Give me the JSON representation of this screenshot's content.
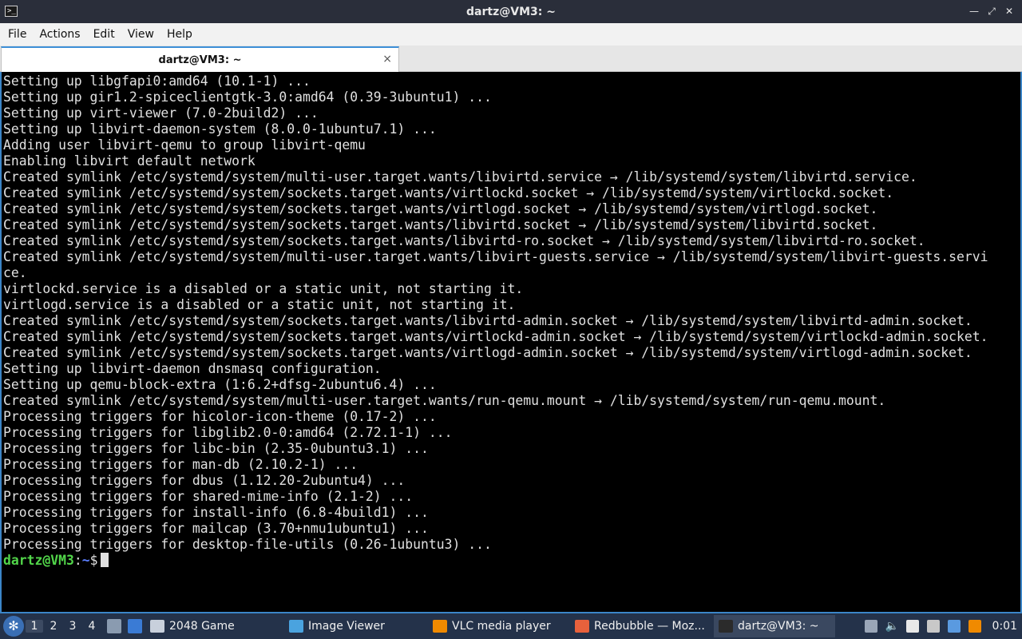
{
  "window": {
    "title": "dartz@VM3: ~"
  },
  "menu": [
    "File",
    "Actions",
    "Edit",
    "View",
    "Help"
  ],
  "tab": {
    "label": "dartz@VM3: ~",
    "close": "×"
  },
  "terminal": {
    "lines": [
      "Setting up libgfapi0:amd64 (10.1-1) ...",
      "Setting up gir1.2-spiceclientgtk-3.0:amd64 (0.39-3ubuntu1) ...",
      "Setting up virt-viewer (7.0-2build2) ...",
      "Setting up libvirt-daemon-system (8.0.0-1ubuntu7.1) ...",
      "Adding user libvirt-qemu to group libvirt-qemu",
      "Enabling libvirt default network",
      "Created symlink /etc/systemd/system/multi-user.target.wants/libvirtd.service → /lib/systemd/system/libvirtd.service.",
      "Created symlink /etc/systemd/system/sockets.target.wants/virtlockd.socket → /lib/systemd/system/virtlockd.socket.",
      "Created symlink /etc/systemd/system/sockets.target.wants/virtlogd.socket → /lib/systemd/system/virtlogd.socket.",
      "Created symlink /etc/systemd/system/sockets.target.wants/libvirtd.socket → /lib/systemd/system/libvirtd.socket.",
      "Created symlink /etc/systemd/system/sockets.target.wants/libvirtd-ro.socket → /lib/systemd/system/libvirtd-ro.socket.",
      "Created symlink /etc/systemd/system/multi-user.target.wants/libvirt-guests.service → /lib/systemd/system/libvirt-guests.servi",
      "ce.",
      "virtlockd.service is a disabled or a static unit, not starting it.",
      "virtlogd.service is a disabled or a static unit, not starting it.",
      "Created symlink /etc/systemd/system/sockets.target.wants/libvirtd-admin.socket → /lib/systemd/system/libvirtd-admin.socket.",
      "Created symlink /etc/systemd/system/sockets.target.wants/virtlockd-admin.socket → /lib/systemd/system/virtlockd-admin.socket.",
      "Created symlink /etc/systemd/system/sockets.target.wants/virtlogd-admin.socket → /lib/systemd/system/virtlogd-admin.socket.",
      "Setting up libvirt-daemon dnsmasq configuration.",
      "Setting up qemu-block-extra (1:6.2+dfsg-2ubuntu6.4) ...",
      "Created symlink /etc/systemd/system/multi-user.target.wants/run-qemu.mount → /lib/systemd/system/run-qemu.mount.",
      "Processing triggers for hicolor-icon-theme (0.17-2) ...",
      "Processing triggers for libglib2.0-0:amd64 (2.72.1-1) ...",
      "Processing triggers for libc-bin (2.35-0ubuntu3.1) ...",
      "Processing triggers for man-db (2.10.2-1) ...",
      "Processing triggers for dbus (1.12.20-2ubuntu4) ...",
      "Processing triggers for shared-mime-info (2.1-2) ...",
      "Processing triggers for install-info (6.8-4build1) ...",
      "Processing triggers for mailcap (3.70+nmu1ubuntu1) ...",
      "Processing triggers for desktop-file-utils (0.26-1ubuntu3) ..."
    ],
    "prompt": {
      "user": "dartz@VM3",
      "separator": ":",
      "path": "~",
      "symbol": "$"
    }
  },
  "taskbar": {
    "workspaces": [
      "1",
      "2",
      "3",
      "4"
    ],
    "active_workspace": "1",
    "tasks": [
      {
        "label": "2048 Game",
        "icon": "window-icon",
        "color": "#c8d0dc"
      },
      {
        "label": "Image Viewer",
        "icon": "image-viewer-icon",
        "color": "#4aa3df"
      },
      {
        "label": "VLC media player",
        "icon": "vlc-icon",
        "color": "#f08a00"
      },
      {
        "label": "Redbubble — Moz...",
        "icon": "firefox-icon",
        "color": "#e8613c"
      },
      {
        "label": "dartz@VM3: ~",
        "icon": "terminal-icon",
        "color": "#2b2b2b",
        "active": true
      }
    ],
    "clock": "0:01"
  },
  "colors": {
    "terminal_bg": "#000000",
    "terminal_fg": "#e0e0e0",
    "prompt_user": "#52d64a",
    "prompt_path": "#5b7fff",
    "focus_border": "#3b85c8"
  }
}
